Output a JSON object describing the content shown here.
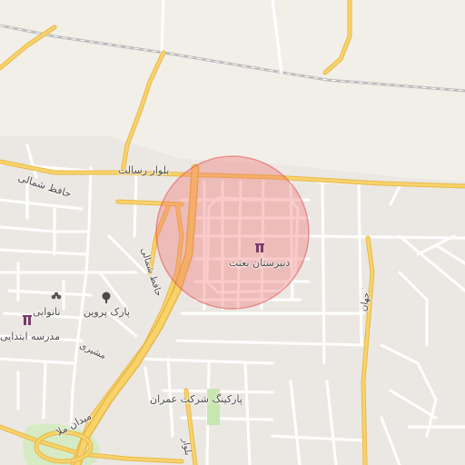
{
  "map": {
    "colors": {
      "background": "#f2efe9",
      "urban": "#ebe8e3",
      "minor_road": "#ffffff",
      "major_road": "#f7d36a",
      "major_road_casing": "#e8b84a",
      "railway": "#b8b8b8",
      "park": "#c8e6b0",
      "highlight_fill": "#f06a6a",
      "highlight_stroke": "#e04a4a"
    },
    "labels": {
      "street_resalat": "بلوار رسالت",
      "street_hafez_shomali_1": "حافظ شمالی",
      "street_hafez_shomali_2": "حافظ شمالی",
      "street_mashiri": "مشیری",
      "street_meydan": "میدان ملا",
      "street_east": "جهان",
      "street_south": "بلوار",
      "poi_school_highlight": "دبیرستان بعثت",
      "poi_bakery": "نانوایی",
      "poi_park_parvin": "پارک پروین",
      "poi_elementary_school": "مدرسه ابتدایی",
      "poi_parking": "پارکینگ شرکت عمران"
    },
    "icons": {
      "school": "school-icon",
      "bakery": "bakery-icon",
      "park": "park-icon"
    }
  }
}
